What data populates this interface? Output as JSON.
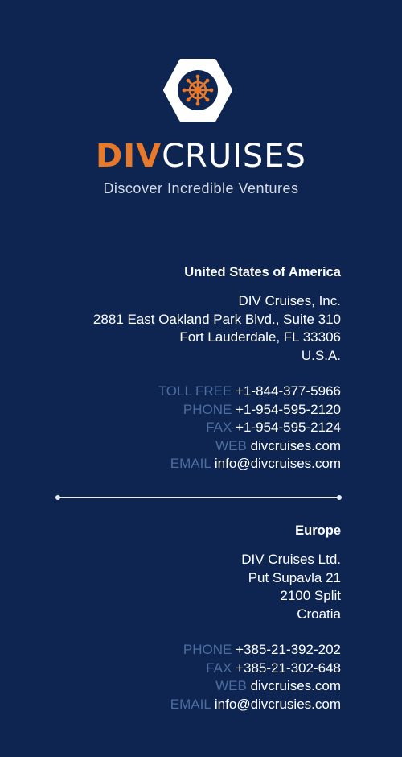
{
  "brand": {
    "name_accent": "DIV",
    "name_main": "CRUISES",
    "tagline": "Discover Incredible Ventures",
    "colors": {
      "accent": "#e8782a",
      "background": "#0d2550",
      "label": "#4d6d9e"
    },
    "logo_icon": "ship-wheel-icon"
  },
  "offices": [
    {
      "region": "United States of America",
      "address": [
        "DIV Cruises, Inc.",
        "2881 East Oakland Park Blvd., Suite 310",
        "Fort Lauderdale, FL 33306",
        "U.S.A."
      ],
      "contacts": [
        {
          "label": "TOLL FREE",
          "value": "+1-844-377-5966"
        },
        {
          "label": "PHONE",
          "value": "+1-954-595-2120"
        },
        {
          "label": "FAX",
          "value": "+1-954-595-2124"
        },
        {
          "label": "WEB",
          "value": "divcruises.com"
        },
        {
          "label": "EMAIL",
          "value": "info@divcruises.com"
        }
      ]
    },
    {
      "region": "Europe",
      "address": [
        "DIV Cruises Ltd.",
        "Put Supavla 21",
        "2100 Split",
        "Croatia"
      ],
      "contacts": [
        {
          "label": "PHONE",
          "value": "+385-21-392-202"
        },
        {
          "label": "FAX",
          "value": "+385-21-302-648"
        },
        {
          "label": "WEB",
          "value": "divcruises.com"
        },
        {
          "label": "EMAIL",
          "value": "info@divcrusies.com"
        }
      ]
    }
  ]
}
